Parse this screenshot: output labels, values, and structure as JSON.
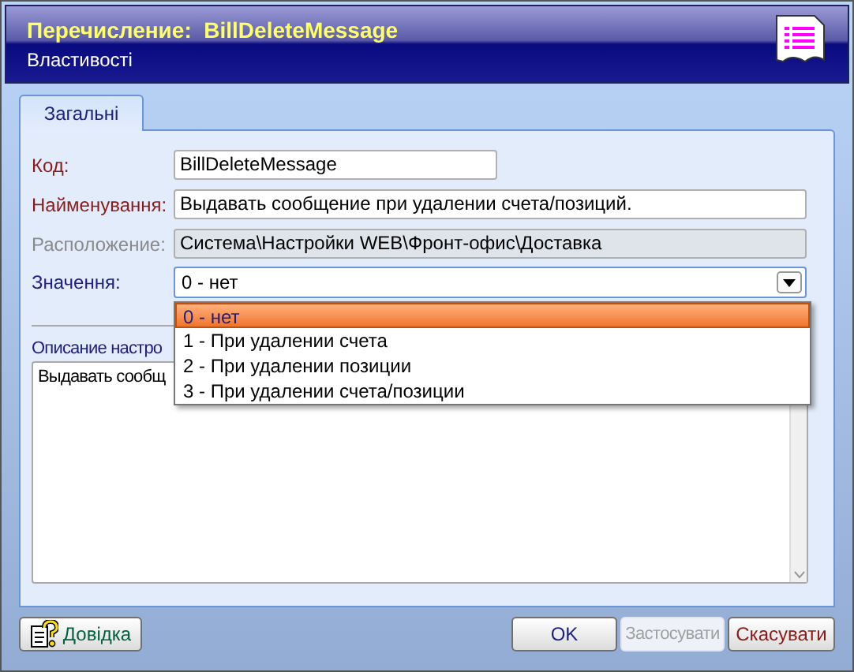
{
  "header": {
    "title": "Перечисление:  BillDeleteMessage",
    "subtitle": "Властивості"
  },
  "tabs": [
    {
      "label": "Загальні",
      "selected": true
    }
  ],
  "fields": [
    {
      "label": "Код:",
      "value": "BillDeleteMessage",
      "disabled": false,
      "required": true
    },
    {
      "label": "Найменування:",
      "value": "Выдавать сообщение при удалении счета/позиций.",
      "disabled": false,
      "required": true
    },
    {
      "label": "Расположение:",
      "value": "Система\\Настройки WEB\\Фронт-офис\\Доставка",
      "disabled": true
    }
  ],
  "value_field": {
    "label": "Значення:",
    "value": "0 - нет",
    "expanded": true,
    "options": [
      {
        "label": "0 - нет",
        "selected": true
      },
      {
        "label": "1 - При удалении счета",
        "selected": false
      },
      {
        "label": "2 - При удалении позиции",
        "selected": false
      },
      {
        "label": "3 - При удалении счета/позиции",
        "selected": false
      }
    ]
  },
  "description": {
    "label": "Описание настро",
    "value": "Выдавать сообщ"
  },
  "buttons": [
    {
      "label": "Довідка",
      "kind": "help",
      "disabled": false
    },
    {
      "label": "OK",
      "kind": "ok",
      "disabled": false
    },
    {
      "label": "Застосувати",
      "kind": "apply",
      "disabled": true
    },
    {
      "label": "Скасувати",
      "kind": "cancel",
      "disabled": false
    }
  ]
}
